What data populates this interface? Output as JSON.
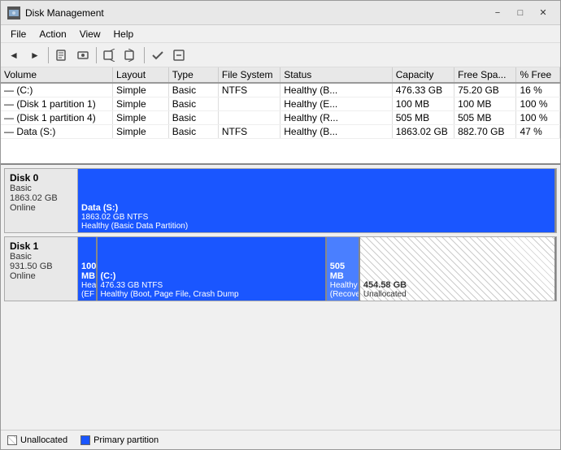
{
  "window": {
    "title": "Disk Management",
    "icon": "disk-icon"
  },
  "menu": {
    "items": [
      "File",
      "Action",
      "View",
      "Help"
    ]
  },
  "toolbar": {
    "buttons": [
      "back",
      "forward",
      "volume-props",
      "disk-props",
      "help1",
      "help2",
      "action1",
      "action2"
    ]
  },
  "table": {
    "columns": [
      "Volume",
      "Layout",
      "Type",
      "File System",
      "Status",
      "Capacity",
      "Free Spa...",
      "% Free"
    ],
    "col_widths": [
      "18%",
      "9%",
      "8%",
      "10%",
      "18%",
      "10%",
      "10%",
      "7%"
    ],
    "rows": [
      {
        "volume": "— (C:)",
        "layout": "Simple",
        "type": "Basic",
        "filesystem": "NTFS",
        "status": "Healthy (B...",
        "capacity": "476.33 GB",
        "free_space": "75.20 GB",
        "pct_free": "16 %"
      },
      {
        "volume": "— (Disk 1 partition 1)",
        "layout": "Simple",
        "type": "Basic",
        "filesystem": "",
        "status": "Healthy (E...",
        "capacity": "100 MB",
        "free_space": "100 MB",
        "pct_free": "100 %"
      },
      {
        "volume": "— (Disk 1 partition 4)",
        "layout": "Simple",
        "type": "Basic",
        "filesystem": "",
        "status": "Healthy (R...",
        "capacity": "505 MB",
        "free_space": "505 MB",
        "pct_free": "100 %"
      },
      {
        "volume": "— Data (S:)",
        "layout": "Simple",
        "type": "Basic",
        "filesystem": "NTFS",
        "status": "Healthy (B...",
        "capacity": "1863.02 GB",
        "free_space": "882.70 GB",
        "pct_free": "47 %"
      }
    ]
  },
  "disks": [
    {
      "name": "Disk 0",
      "type": "Basic",
      "size": "1863.02 GB",
      "status": "Online",
      "partitions": [
        {
          "label": "Data (S:)",
          "sublabel": "1863.02 GB NTFS",
          "status": "Healthy (Basic Data Partition)",
          "type": "primary",
          "width_pct": 100
        }
      ]
    },
    {
      "name": "Disk 1",
      "type": "Basic",
      "size": "931.50 GB",
      "status": "Online",
      "partitions": [
        {
          "label": "100 MB",
          "sublabel": "Healthy (EF",
          "status": "",
          "type": "primary",
          "width_pct": 4
        },
        {
          "label": "(C:)",
          "sublabel": "476.33 GB NTFS",
          "status": "Healthy (Boot, Page File, Crash Dump",
          "type": "primary",
          "width_pct": 48
        },
        {
          "label": "505 MB",
          "sublabel": "Healthy (Recove",
          "status": "",
          "type": "recovery",
          "width_pct": 7
        },
        {
          "label": "454.58 GB",
          "sublabel": "Unallocated",
          "status": "",
          "type": "unallocated",
          "width_pct": 41
        }
      ]
    }
  ],
  "legend": {
    "items": [
      {
        "type": "unallocated",
        "label": "Unallocated"
      },
      {
        "type": "primary",
        "label": "Primary partition"
      }
    ]
  }
}
